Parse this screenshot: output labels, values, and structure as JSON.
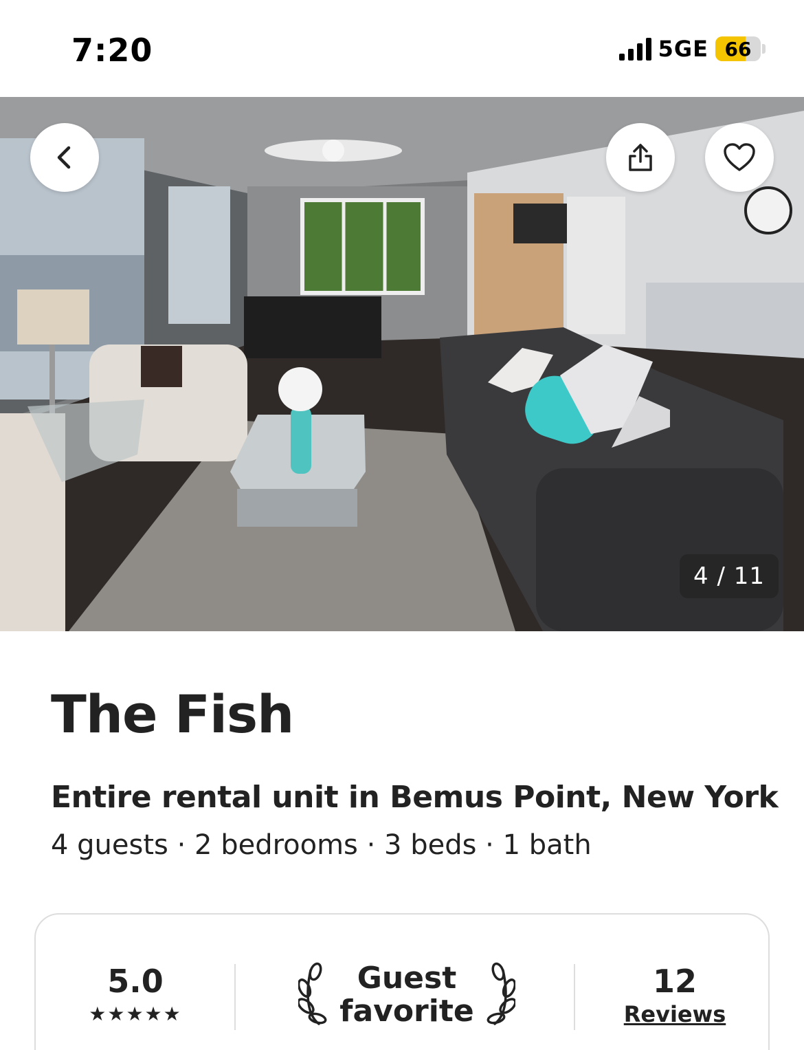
{
  "status_bar": {
    "time": "7:20",
    "network": "5GE",
    "battery": "66",
    "battery_level": 0.66
  },
  "photo": {
    "counter": "4 / 11",
    "back_icon": "chevron-left-icon",
    "share_icon": "share-icon",
    "favorite_icon": "heart-icon"
  },
  "listing": {
    "title": "The Fish",
    "subtitle": "Entire rental unit in Bemus Point, New York",
    "details": "4 guests · 2 bedrooms · 3 beds · 1 bath"
  },
  "rating_card": {
    "rating": "5.0",
    "stars": "★★★★★",
    "badge_line1": "Guest",
    "badge_line2": "favorite",
    "reviews_count": "12",
    "reviews_label": "Reviews"
  }
}
